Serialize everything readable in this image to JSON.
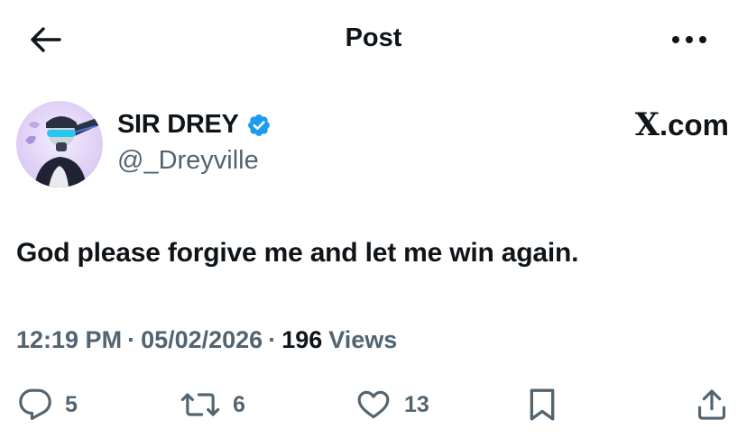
{
  "header": {
    "title": "Post",
    "back_icon": "arrow-left-icon",
    "more_icon": "more-horizontal-icon"
  },
  "author": {
    "display_name": "SIR DREY",
    "handle": "@_Dreyville",
    "verified": true,
    "verified_color": "#1d9bf0"
  },
  "source": {
    "logo_letter": "X",
    "domain": ".com"
  },
  "post": {
    "text": "God please forgive me and let me win again."
  },
  "meta": {
    "time": "12:19 PM",
    "separator": "·",
    "date": "05/02/2026",
    "views_count": "196",
    "views_label": "Views"
  },
  "actions": {
    "replies": "5",
    "reposts": "6",
    "likes": "13"
  },
  "colors": {
    "text_primary": "#0f1419",
    "text_secondary": "#536471",
    "accent": "#1d9bf0"
  }
}
